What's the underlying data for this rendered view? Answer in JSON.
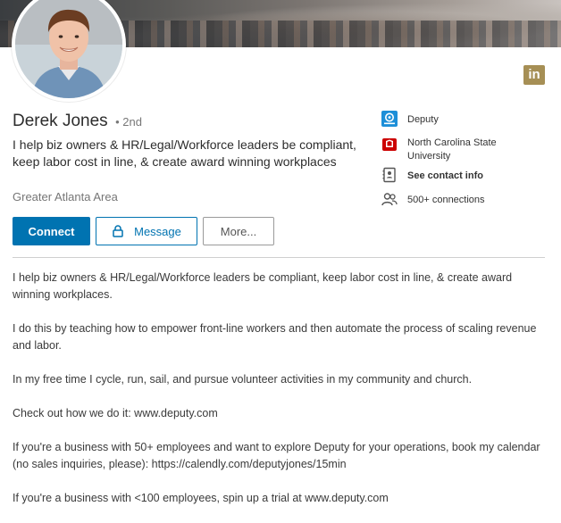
{
  "profile": {
    "name": "Derek Jones",
    "degree": "• 2nd",
    "headline": "I help biz owners & HR/Legal/Workforce leaders be compliant, keep labor cost in line, & create award winning workplaces",
    "location": "Greater Atlanta Area"
  },
  "brand": {
    "logo_text": "in",
    "logo_color": "#a68f55"
  },
  "sidebar": {
    "company": "Deputy",
    "school": "North Carolina State University",
    "contact": "See contact info",
    "connections": "500+ connections"
  },
  "actions": {
    "connect": "Connect",
    "message": "Message",
    "more": "More..."
  },
  "about": {
    "paragraphs": [
      "I help biz owners & HR/Legal/Workforce leaders be compliant, keep labor cost in line, & create award winning workplaces.",
      "I do this by teaching how to empower front-line workers and then automate the process of scaling revenue and labor.",
      "In my free time I cycle, run, sail, and pursue volunteer activities in my community and church.",
      "Check out how we do it: www.deputy.com",
      "If you're a business with 50+ employees and want to explore Deputy for your operations, book my calendar (no sales inquiries, please): https://calendly.com/deputyjones/15min",
      "If you're a business with <100 employees, spin up a trial at www.deputy.com"
    ]
  },
  "colors": {
    "primary": "#0073b1",
    "deputy_blue": "#1d8fd8",
    "ncsu_red": "#cc0000"
  },
  "icons": [
    "deputy-logo-icon",
    "ncsu-logo-icon",
    "contact-card-icon",
    "connections-icon",
    "lock-icon",
    "linkedin-icon"
  ]
}
